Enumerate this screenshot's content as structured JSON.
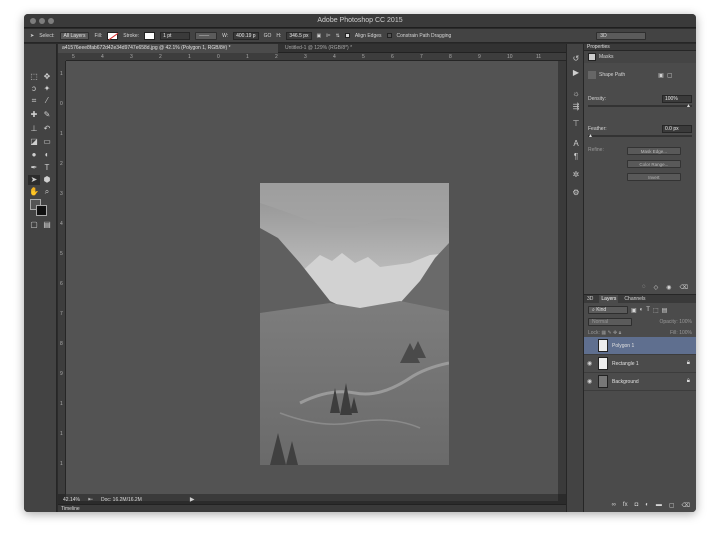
{
  "window": {
    "title": "Adobe Photoshop CC 2015"
  },
  "options_bar": {
    "select_label": "Select:",
    "select_value": "All Layers",
    "fill_label": "Fill:",
    "stroke_label": "Stroke:",
    "stroke_width": "1 pt",
    "w_label": "W:",
    "w_value": "400.19 p",
    "go_label": "GO",
    "h_label": "H:",
    "h_value": "346.5 px",
    "align_edges": "Align Edges",
    "constrain": "Constrain Path Dragging",
    "workspace": "3D"
  },
  "doc_tabs": [
    {
      "label": "a41576eee8fab672d42e34d9747e658d.jpg @ 42.1% (Polygon 1, RGB/8#) *"
    },
    {
      "label": "Untitled-1 @ 129% (RGB/8*) *"
    }
  ],
  "ruler_top": [
    "5",
    "4",
    "3",
    "2",
    "1",
    "0",
    "1",
    "2",
    "3",
    "4",
    "5",
    "6",
    "7",
    "8",
    "9",
    "10",
    "11"
  ],
  "ruler_left": [
    "1",
    "0",
    "1",
    "2",
    "3",
    "4",
    "5",
    "6",
    "7",
    "8",
    "9",
    "1",
    "1",
    "1"
  ],
  "status": {
    "zoom": "42.14%",
    "doc": "Doc: 16.2M/16.2M"
  },
  "timeline": {
    "label": "Timeline"
  },
  "properties": {
    "header": "Properties",
    "masks_label": "Masks",
    "shape_path": "Shape Path",
    "density_label": "Density:",
    "density_value": "100%",
    "density_level": 100,
    "feather_label": "Feather:",
    "feather_value": "0.0 px",
    "feather_level": 0,
    "refine_label": "Refine:",
    "mask_edge": "Mask Edge...",
    "color_range": "Color Range...",
    "invert": "Invert"
  },
  "layers_panel": {
    "tabs": [
      "3D",
      "Layers",
      "Channels"
    ],
    "kind": "Kind",
    "blend": "Normal",
    "opacity_label": "Opacity:",
    "opacity_value": "100%",
    "lock_label": "Lock:",
    "fill_label": "Fill:",
    "fill_value": "100%",
    "layers": [
      {
        "name": "Polygon 1",
        "selected": true
      },
      {
        "name": "Rectangle 1",
        "selected": false
      },
      {
        "name": "Background",
        "selected": false
      }
    ]
  },
  "colors": {
    "accent": "#5f6f8f",
    "panel": "#4b4b4b",
    "canvas": "#535353"
  }
}
